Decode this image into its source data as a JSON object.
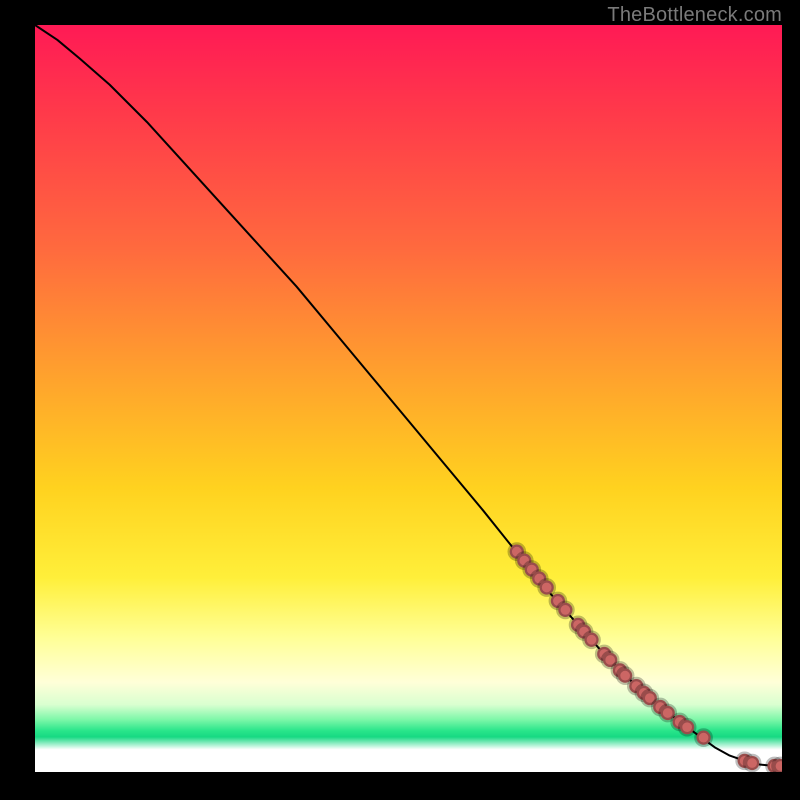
{
  "watermark": "TheBottleneck.com",
  "colors": {
    "marker": "#cc6664",
    "curve": "#000000",
    "frame": "#000000"
  },
  "chart_data": {
    "type": "line",
    "title": "",
    "xlabel": "",
    "ylabel": "",
    "xlim": [
      0,
      100
    ],
    "ylim": [
      0,
      100
    ],
    "grid": false,
    "legend": false,
    "annotations": [],
    "series": [
      {
        "name": "curve",
        "comment": "Bottleneck-vs-performance style curve; black line read off gridless plot. Values are approximate normalized 0-100 on both axes.",
        "x": [
          0,
          3,
          6,
          10,
          15,
          20,
          25,
          30,
          35,
          40,
          45,
          50,
          55,
          60,
          64,
          68,
          72,
          76,
          80,
          84,
          88,
          91,
          93,
          95,
          97,
          99,
          100
        ],
        "y": [
          100,
          98,
          95.5,
          92,
          87,
          81.5,
          76,
          70.5,
          65,
          59,
          53,
          47,
          41,
          35,
          30,
          25,
          20.5,
          16,
          12,
          8.5,
          5.5,
          3.3,
          2.2,
          1.5,
          1.0,
          0.8,
          0.8
        ]
      }
    ],
    "markers": {
      "name": "highlighted-points",
      "comment": "Salmon markers along lower-right portion of curve",
      "points": [
        {
          "x": 64.5,
          "y": 29.5
        },
        {
          "x": 65.5,
          "y": 28.3
        },
        {
          "x": 66.5,
          "y": 27.1
        },
        {
          "x": 67.5,
          "y": 25.9
        },
        {
          "x": 68.5,
          "y": 24.7
        },
        {
          "x": 70.0,
          "y": 22.9
        },
        {
          "x": 71.0,
          "y": 21.7
        },
        {
          "x": 72.7,
          "y": 19.7
        },
        {
          "x": 73.5,
          "y": 18.8
        },
        {
          "x": 74.5,
          "y": 17.7
        },
        {
          "x": 76.2,
          "y": 15.8
        },
        {
          "x": 77.0,
          "y": 15.0
        },
        {
          "x": 78.3,
          "y": 13.6
        },
        {
          "x": 79.0,
          "y": 12.9
        },
        {
          "x": 80.5,
          "y": 11.5
        },
        {
          "x": 81.5,
          "y": 10.6
        },
        {
          "x": 82.3,
          "y": 9.9
        },
        {
          "x": 83.7,
          "y": 8.7
        },
        {
          "x": 84.7,
          "y": 7.9
        },
        {
          "x": 86.3,
          "y": 6.7
        },
        {
          "x": 87.3,
          "y": 6.0
        },
        {
          "x": 89.5,
          "y": 4.6
        },
        {
          "x": 95.0,
          "y": 1.5
        },
        {
          "x": 96.0,
          "y": 1.2
        },
        {
          "x": 99.0,
          "y": 0.8
        },
        {
          "x": 99.8,
          "y": 0.8
        }
      ]
    }
  }
}
